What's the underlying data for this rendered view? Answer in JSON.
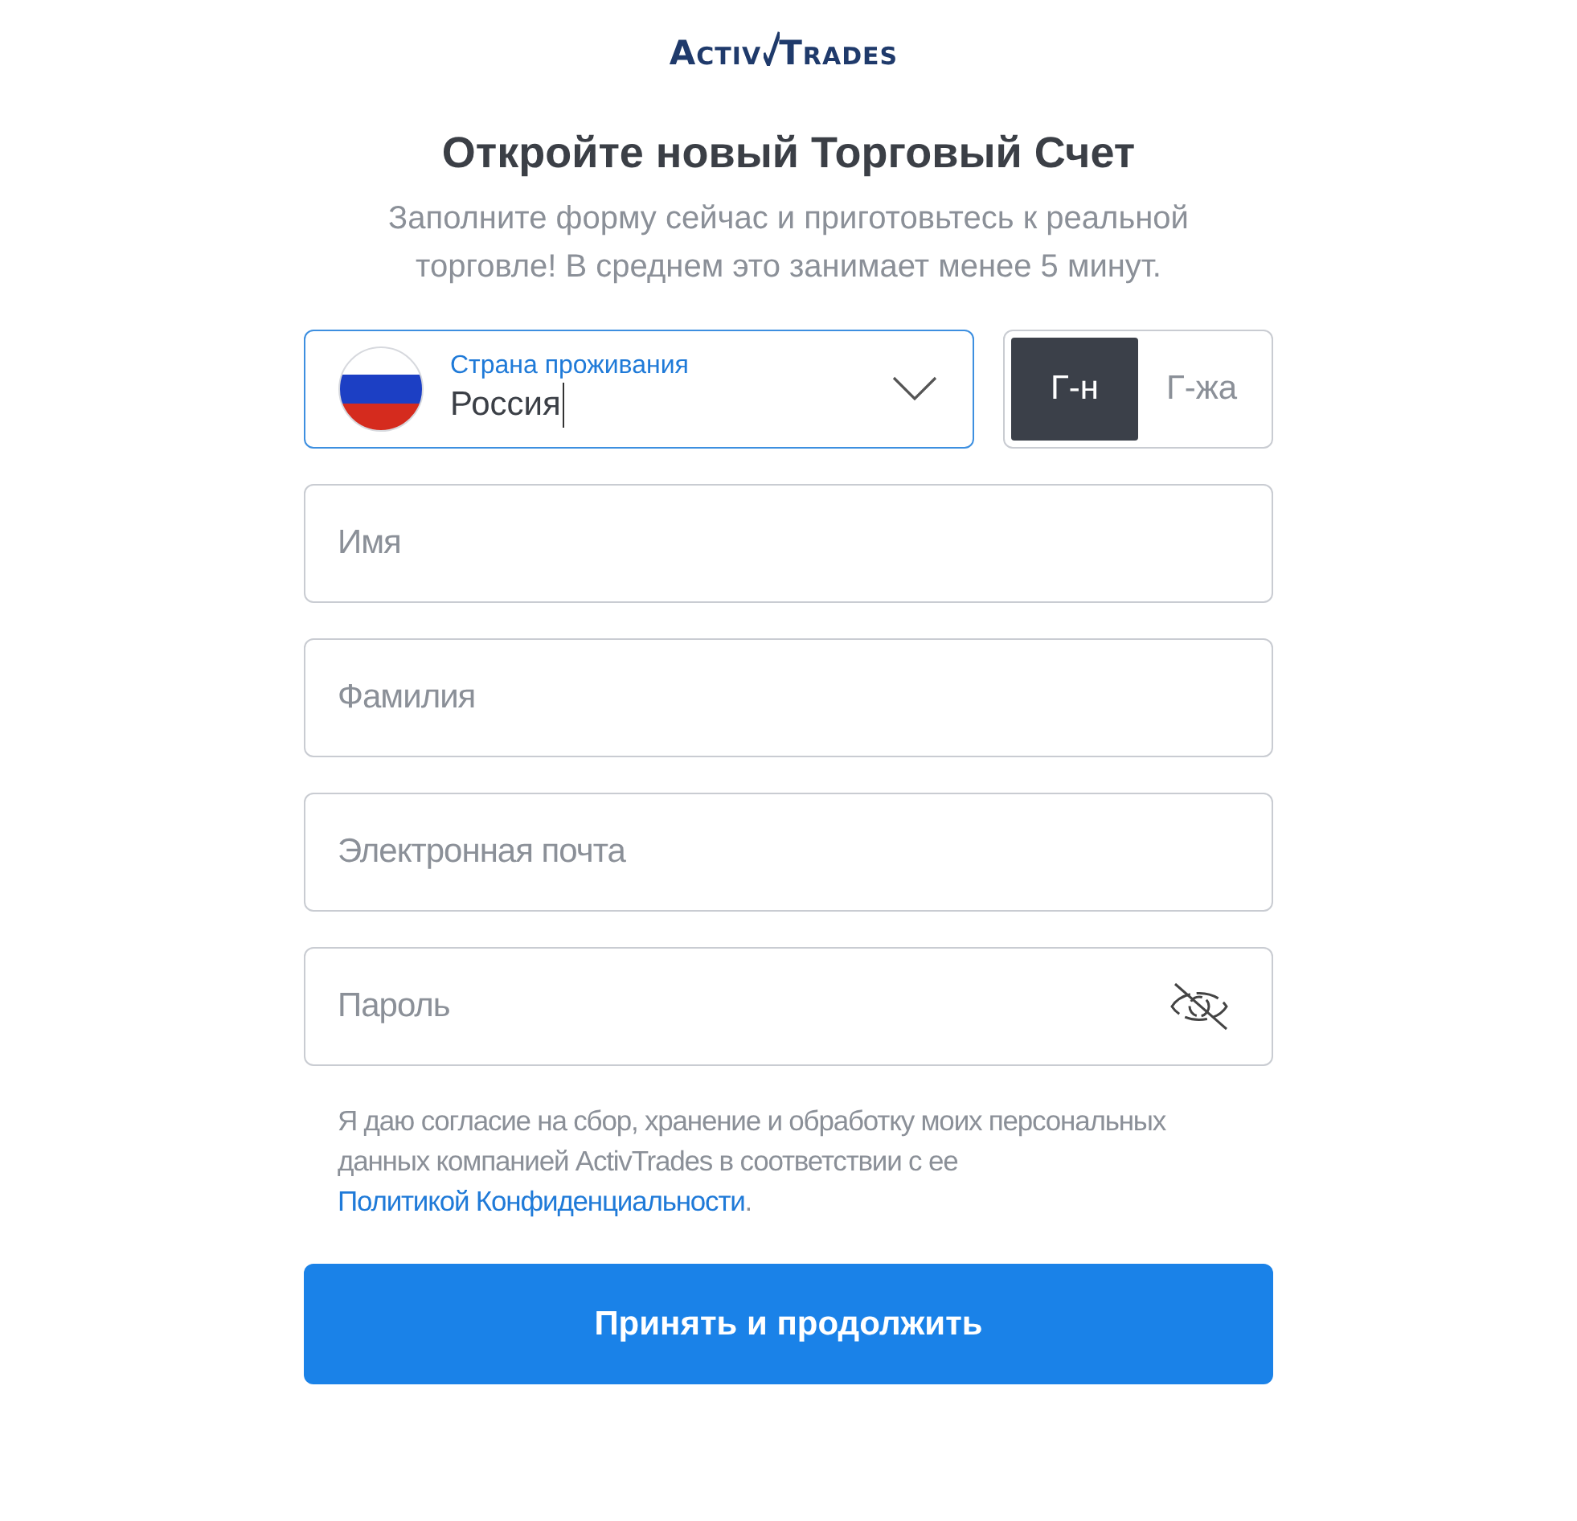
{
  "logo": {
    "parts": [
      "ACTIV",
      "TRADES"
    ]
  },
  "title": "Откройте новый Торговый Счет",
  "subtitle": "Заполните форму сейчас и приготовьтесь к реальной торговле! В среднем это занимает менее 5 минут.",
  "country": {
    "label": "Страна проживания",
    "value": "Россия"
  },
  "salutation": [
    {
      "label": "Г-н",
      "selected": true
    },
    {
      "label": "Г-жа",
      "selected": false
    }
  ],
  "fields": [
    {
      "placeholder": "Имя",
      "kind": "text"
    },
    {
      "placeholder": "Фамилия",
      "kind": "text"
    },
    {
      "placeholder": "Электронная почта",
      "kind": "email"
    },
    {
      "placeholder": "Пароль",
      "kind": "password"
    }
  ],
  "consent": {
    "text": "Я даю согласие на сбор, хранение и обработку моих персональных данных компанией ActivTrades в соответствии с ее ",
    "link": "Политикой Конфиденциальности",
    "after": "."
  },
  "submit": "Принять и продолжить"
}
